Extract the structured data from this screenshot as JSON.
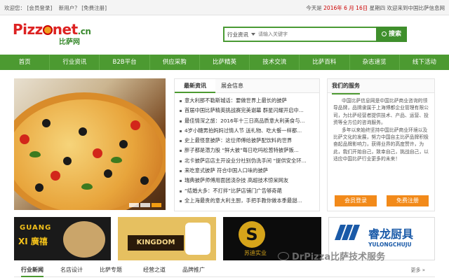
{
  "topbar": {
    "welcome": "欢迎您：",
    "member_login": "[会员登录]",
    "new_user": "新用户？",
    "free_register": "[免费注册]",
    "date_prefix": "今天是",
    "date": "2016年 6 月 16日",
    "weekday": "星期四",
    "welcome_right": "欢迎来到中国比萨信息网"
  },
  "logo": {
    "word_a": "Pizz",
    "word_b": "net",
    "word_c": ".cn",
    "sub": "比萨网"
  },
  "search": {
    "category": "行业资讯",
    "placeholder": "请输入关键字",
    "button": "搜索"
  },
  "nav": {
    "items": [
      "首页",
      "行业资讯",
      "B2B平台",
      "供应采购",
      "比萨精英",
      "技术交流",
      "比萨百科",
      "杂志速览",
      "线下活动"
    ]
  },
  "news": {
    "tabs": [
      "最新资讯",
      "展会信息"
    ],
    "items": [
      "意大利那不勒斯城话：要做世界上最长的披萨",
      "首届中国比萨精英挑战赛完美谢幕 群星闪耀开启中...",
      "最佳情深之旅：2016年十三日高品质意大利美食与...",
      "4岁小糖男拍妈妈过情人节 送礼物、吃大餐一样都...",
      "史上最怪意披萨：这位师傅给披萨配饮料的世界",
      "胖子都是潜力股 “鲜大披”每日吃吗松葱特披萨贩...",
      "北卡披萨店店主开设业分社别伪洗手间 “提供安全环...",
      "来吃意式披萨 符合中国人口味的披萨",
      "瑞典披萨师傅用面团浇杂技 高超技术惊呆网友",
      "“结婚大多：不打拌”比萨店铺门广告够奇葩",
      "全上海最贵的意大利主厨，手把手教你做本季最甜..."
    ]
  },
  "service": {
    "title": "我们的服务",
    "paragraphs": [
      "中国比萨信息网是中国比萨商业咨询的领导品牌，品牌隶属于上海博都企业管理有限公司，为比萨经营者提供技术、产品、运营、投资等全方位的咨询服务。",
      "多年以来始终坚持中国比萨商业环境以及比萨文化的发展，努力中国自主比萨品牌积极奋起品牌影响力，获得业界的高度赞许，为此，我们开始自己，致幸自己，挑战自己，以适应中国比萨行业更多的未来！"
    ],
    "btn_login": "会员登录",
    "btn_register": "免费注册"
  },
  "ads": {
    "a1_en": "GUANG",
    "a1_cn": "XI 廣禧",
    "a2_text": "KINGDOM",
    "a3_text": "苏迪实业",
    "a4_brand": "睿龙厨具",
    "a4_en": "YULONGCHUJU"
  },
  "watermark": "DrPizza比萨技术服务",
  "bottom_tabs": {
    "items": [
      "行业新闻",
      "名店设计",
      "比萨专题",
      "经营之道",
      "品牌推广"
    ],
    "more": "更多 »"
  }
}
